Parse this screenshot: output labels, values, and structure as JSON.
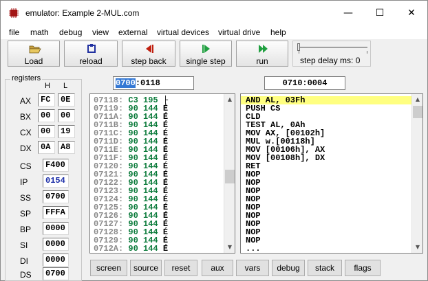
{
  "window": {
    "title": "emulator: Example 2-MUL.com",
    "minimize_glyph": "—",
    "maximize_glyph": "☐",
    "close_glyph": "✕"
  },
  "menu": [
    "file",
    "math",
    "debug",
    "view",
    "external",
    "virtual devices",
    "virtual drive",
    "help"
  ],
  "toolbar": {
    "load": {
      "label": "Load",
      "icon": "folder-open-icon"
    },
    "reload": {
      "label": "reload",
      "icon": "reload-icon"
    },
    "step_back": {
      "label": "step back",
      "icon": "step-back-icon"
    },
    "single_step": {
      "label": "single step",
      "icon": "single-step-icon"
    },
    "run": {
      "label": "run",
      "icon": "run-icon"
    },
    "step_delay_label": "step delay ms: 0",
    "step_delay_value": 0
  },
  "registers": {
    "title": "registers",
    "h_label": "H",
    "l_label": "L",
    "general": [
      {
        "name": "AX",
        "h": "FC",
        "l": "0E"
      },
      {
        "name": "BX",
        "h": "00",
        "l": "00"
      },
      {
        "name": "CX",
        "h": "00",
        "l": "19"
      },
      {
        "name": "DX",
        "h": "0A",
        "l": "A8"
      }
    ],
    "segment": [
      {
        "name": "CS",
        "value": "F400"
      },
      {
        "name": "IP",
        "value": "0154"
      },
      {
        "name": "SS",
        "value": "0700"
      },
      {
        "name": "SP",
        "value": "FFFA"
      },
      {
        "name": "BP",
        "value": "0000"
      },
      {
        "name": "SI",
        "value": "0000"
      },
      {
        "name": "DI",
        "value": "0000"
      },
      {
        "name": "DS",
        "value": "0700"
      }
    ]
  },
  "memory_address": {
    "segment": "0700",
    "offset": ":0118"
  },
  "disasm_address": "0710:0004",
  "memory_rows": [
    {
      "addr": "07118:",
      "hex": "C3",
      "dec": "195",
      "chr": "├"
    },
    {
      "addr": "07119:",
      "hex": "90",
      "dec": "144",
      "chr": "É"
    },
    {
      "addr": "0711A:",
      "hex": "90",
      "dec": "144",
      "chr": "É"
    },
    {
      "addr": "0711B:",
      "hex": "90",
      "dec": "144",
      "chr": "É"
    },
    {
      "addr": "0711C:",
      "hex": "90",
      "dec": "144",
      "chr": "É"
    },
    {
      "addr": "0711D:",
      "hex": "90",
      "dec": "144",
      "chr": "É"
    },
    {
      "addr": "0711E:",
      "hex": "90",
      "dec": "144",
      "chr": "É"
    },
    {
      "addr": "0711F:",
      "hex": "90",
      "dec": "144",
      "chr": "É"
    },
    {
      "addr": "07120:",
      "hex": "90",
      "dec": "144",
      "chr": "É"
    },
    {
      "addr": "07121:",
      "hex": "90",
      "dec": "144",
      "chr": "É"
    },
    {
      "addr": "07122:",
      "hex": "90",
      "dec": "144",
      "chr": "É"
    },
    {
      "addr": "07123:",
      "hex": "90",
      "dec": "144",
      "chr": "É"
    },
    {
      "addr": "07124:",
      "hex": "90",
      "dec": "144",
      "chr": "É"
    },
    {
      "addr": "07125:",
      "hex": "90",
      "dec": "144",
      "chr": "É"
    },
    {
      "addr": "07126:",
      "hex": "90",
      "dec": "144",
      "chr": "É"
    },
    {
      "addr": "07127:",
      "hex": "90",
      "dec": "144",
      "chr": "É"
    },
    {
      "addr": "07128:",
      "hex": "90",
      "dec": "144",
      "chr": "É"
    },
    {
      "addr": "07129:",
      "hex": "90",
      "dec": "144",
      "chr": "É"
    },
    {
      "addr": "0712A:",
      "hex": "90",
      "dec": "144",
      "chr": "É"
    }
  ],
  "disasm_lines": [
    "AND AL, 03Fh",
    "PUSH CS",
    "CLD",
    "TEST AL, 0Ah",
    "MOV AX, [00102h]",
    "MUL w.[00118h]",
    "MOV [00106h], AX",
    "MOV [00108h], DX",
    "RET",
    "NOP",
    "NOP",
    "NOP",
    "NOP",
    "NOP",
    "NOP",
    "NOP",
    "NOP",
    "NOP",
    "..."
  ],
  "bottom_buttons": [
    "screen",
    "source",
    "reset",
    "aux",
    "vars",
    "debug",
    "stack",
    "flags"
  ],
  "colors": {
    "current_line": "#ffff80",
    "memory_hex": "#0a7a3a",
    "memory_addr": "#8a8a8a",
    "ip_value": "#1c2ea8",
    "selection": "#3478d4"
  }
}
